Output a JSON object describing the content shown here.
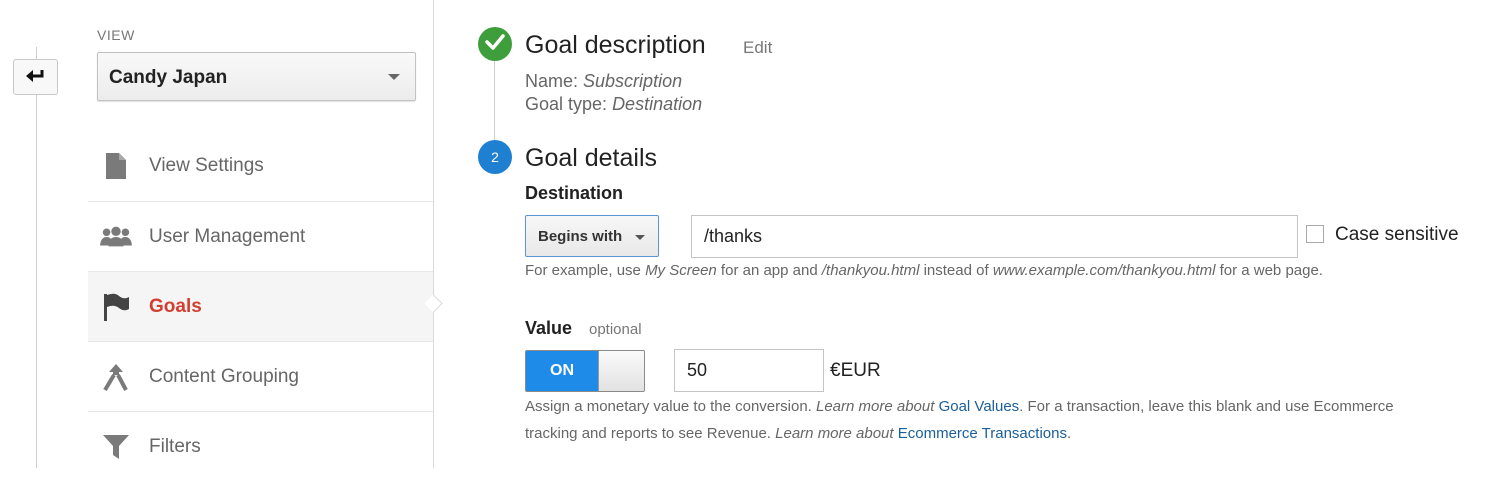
{
  "nav": {
    "back_icon": "back-arrow-icon",
    "view_label": "VIEW",
    "view_selected": "Candy Japan",
    "items": [
      {
        "label": "View Settings",
        "icon": "document-icon"
      },
      {
        "label": "User Management",
        "icon": "users-icon"
      },
      {
        "label": "Goals",
        "icon": "flag-icon",
        "active": true
      },
      {
        "label": "Content Grouping",
        "icon": "grouping-icon"
      },
      {
        "label": "Filters",
        "icon": "filter-icon"
      }
    ]
  },
  "step1": {
    "title": "Goal description",
    "edit_label": "Edit",
    "name_prefix": "Name:",
    "name_value": "Subscription",
    "type_prefix": "Goal type:",
    "type_value": "Destination",
    "status_icon": "checkmark-icon",
    "status_color": "#3f9e3c"
  },
  "step2": {
    "number": "2",
    "title": "Goal details",
    "destination_label": "Destination",
    "match_type": "Begins with",
    "destination_value": "/thanks",
    "case_sensitive_label": "Case sensitive",
    "case_sensitive_checked": false,
    "help": {
      "p1": "For example, use ",
      "e1": "My Screen",
      "p2": " for an app and ",
      "e2": "/thankyou.html",
      "p3": " instead of ",
      "e3": "www.example.com/thankyou.html",
      "p4": " for a web page."
    },
    "value_label": "Value",
    "value_optional": "optional",
    "toggle_label": "ON",
    "value_amount": "50",
    "currency": "€EUR",
    "value_help": {
      "t1": "Assign a monetary value to the conversion. ",
      "t2": "Learn more about ",
      "link1": "Goal Values",
      "t3": ". For a transaction, leave this blank and use Ecommerce",
      "t4": "tracking and reports to see Revenue. ",
      "t5": "Learn more about ",
      "link2": "Ecommerce Transactions",
      "t6": "."
    },
    "accent_color": "#1f8be8"
  }
}
